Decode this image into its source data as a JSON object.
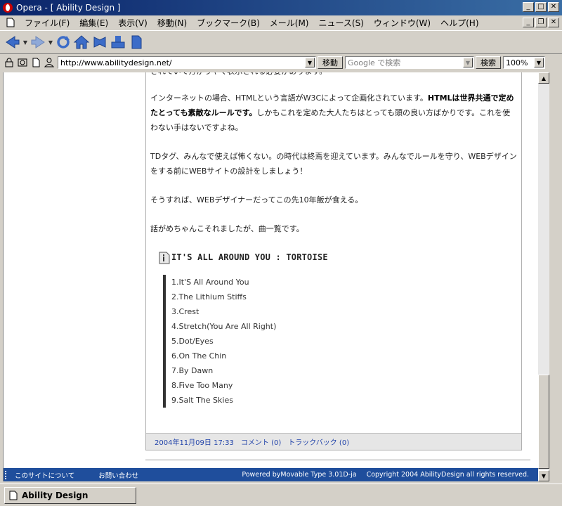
{
  "window": {
    "title": "Opera - [ Ability Design ]"
  },
  "menu": {
    "items": [
      "ファイル(F)",
      "編集(E)",
      "表示(V)",
      "移動(N)",
      "ブックマーク(B)",
      "メール(M)",
      "ニュース(S)",
      "ウィンドウ(W)",
      "ヘルプ(H)"
    ]
  },
  "address": {
    "url": "http://www.abilitydesign.net/",
    "go_label": "移動",
    "search_placeholder": "Google で検索",
    "search_label": "検索",
    "zoom": "100%"
  },
  "article": {
    "cut_line": "されていて方がうやく表示される必要があります。",
    "p1_pre": "インターネットの場合、HTMLという言語がW3Cによって企画化されています。",
    "p1_bold": "HTMLは世界共通で定めたとっても素敵なルールです。",
    "p1_post": "しかもこれを定めた大人たちはとっても頭の良い方ばかりです。これを使わない手はないですよね。",
    "p2": "TDタグ、みんなで使えば怖くない。の時代は終焉を迎えています。みんなでルールを守り、WEBデザインをする前にWEBサイトの設計をしましょう！",
    "p3": "そうすれば、WEBデザイナーだってこの先10年飯が食える。",
    "p4": "話がめちゃんこそれましたが、曲一覧です。",
    "heading": "IT'S ALL AROUND YOU : TORTOISE"
  },
  "chart_data": {
    "type": "table",
    "title": "IT'S ALL AROUND YOU : TORTOISE",
    "tracks": [
      "1.It'S All Around You",
      "2.The Lithium Stiffs",
      "3.Crest",
      "4.Stretch(You Are All Right)",
      "5.Dot/Eyes",
      "6.On The Chin",
      "7.By Dawn",
      "8.Five Too Many",
      "9.Salt The Skies"
    ]
  },
  "entry_footer": {
    "date": "2004年11月09日 17:33",
    "comment": "コメント (0)",
    "trackback": "トラックバック (0)"
  },
  "page_footer": {
    "about": "このサイトについて",
    "contact": "お問い合わせ",
    "powered": "Powered byMovable Type 3.01D-ja",
    "copyright": "Copyright 2004 AbilityDesign all rights reserved."
  },
  "tab": {
    "label": "Ability Design"
  },
  "colors": {
    "title_bar": "#0a246a",
    "footer_bar": "#1f4e9c",
    "link": "#2244aa"
  }
}
